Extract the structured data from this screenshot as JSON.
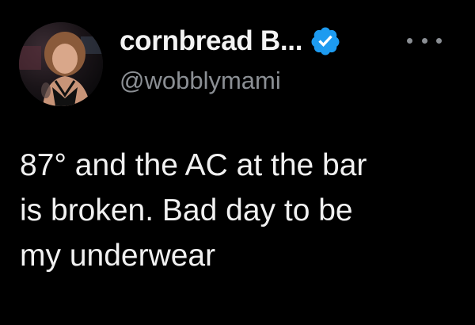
{
  "author": {
    "display_name": "cornbread B...",
    "handle": "@wobblymami",
    "verified": true,
    "avatar_icon": "profile-photo-avatar"
  },
  "menu": {
    "icon": "more-options-icon"
  },
  "tweet": {
    "lines": [
      "87° and the AC at the bar",
      "is broken. Bad day to be",
      "my underwear"
    ]
  },
  "colors": {
    "background": "#000000",
    "text": "#e7e9ea",
    "secondary_text": "#8b8f94",
    "verified_badge": "#1d9bf0"
  }
}
